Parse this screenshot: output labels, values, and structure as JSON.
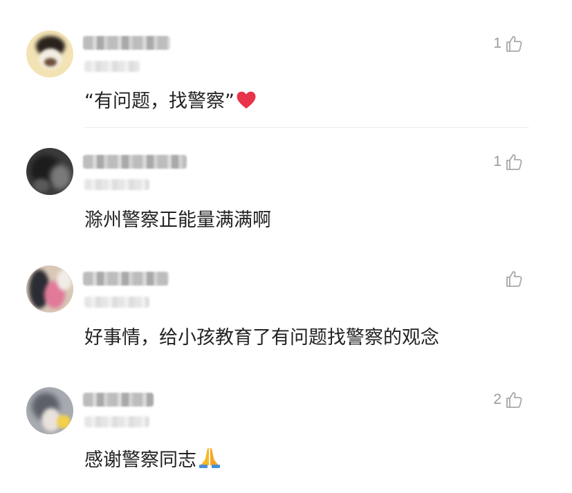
{
  "comments": [
    {
      "text": "“有问题，找警察”",
      "likes": "1",
      "trailing_icon": "red-heart-icon"
    },
    {
      "text": "滁州警察正能量满满啊",
      "likes": "1",
      "trailing_icon": ""
    },
    {
      "text": "好事情，给小孩教育了有问题找警察的观念",
      "likes": "",
      "trailing_icon": ""
    },
    {
      "text": "感谢警察同志",
      "likes": "2",
      "trailing_icon": "folded-hands-icon"
    }
  ],
  "colors": {
    "text": "#222222",
    "like_count": "#9a9a9a",
    "heart": "#e8334a",
    "divider": "#ececec"
  }
}
